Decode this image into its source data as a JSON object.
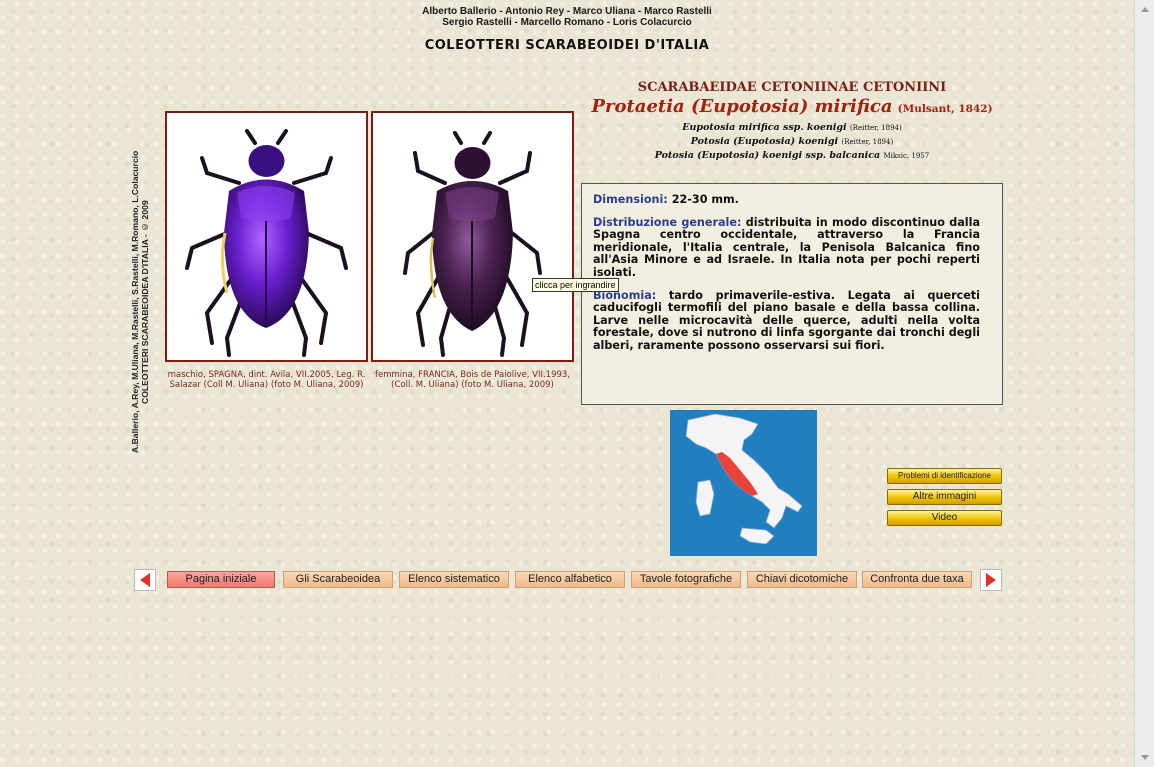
{
  "header": {
    "authors_line1": "Alberto Ballerio - Antonio Rey - Marco Uliana - Marco Rastelli",
    "authors_line2": "Sergio Rastelli - Marcello Romano - Loris Colacurcio",
    "site_title": "COLEOTTERI SCARABEOIDEI D'ITALIA"
  },
  "sidebar_credit": {
    "line1": "A.Ballerio, A.Rey, M.Uliana, M.Rastelli, S.Rastelli, M.Romano, L.Colacurcio",
    "line2": "COLEOTTERI SCARABEOIDEA D'ITALIA - © 2009"
  },
  "photos": [
    {
      "caption": "maschio, SPAGNA, dint. Avila, VII.2005, Leg. R. Salazar (Coll M. Uliana) (foto M. Uliana, 2009)"
    },
    {
      "caption": "femmina, FRANCIA, Bois de Paiolive, VII.1993, (Coll. M. Uliana) (foto M. Uliana, 2009)"
    }
  ],
  "tooltip": "clicca per ingrandire",
  "taxon": {
    "family": "SCARABAEIDAE CETONIINAE CETONIINI",
    "name": "Protaetia (Eupotosia) mirifica",
    "author": "(Mulsant, 1842)",
    "synonyms": [
      {
        "name": "Eupotosia mirifica ssp. koenigi",
        "author": "(Reitter, 1894)"
      },
      {
        "name": "Potosia (Eupotosia) koenigi",
        "author": "(Reitter, 1894)"
      },
      {
        "name": "Potosia (Eupotosia) koenigi ssp. balcanica",
        "author": "Miksic, 1957"
      }
    ]
  },
  "info": {
    "dim_label": "Dimensioni:",
    "dim_text": " 22-30 mm.",
    "distr_label": "Distribuzione generale:",
    "distr_text": " distribuita in modo discontinuo dalla Spagna centro occidentale, attraverso la Francia meridionale, l'Italia centrale, la Penisola Balcanica fino all'Asia Minore e ad Israele. In Italia nota per pochi reperti isolati.",
    "bio_label": "Bionomia:",
    "bio_text": " tardo primaverile-estiva.  Legata ai querceti caducifogli termofili del piano basale e della bassa collina. Larve nelle microcavità delle querce, adulti nella volta forestale, dove si nutrono di linfa sgorgante dai tronchi degli alberi,  raramente possono osservarsi sui fiori."
  },
  "side_buttons": {
    "problems": "Problemi di identificazione",
    "more_images": "Altre immagini",
    "video": "Video"
  },
  "nav": {
    "items": [
      "Pagina iniziale",
      "Gli Scarabeoidea",
      "Elenco sistematico",
      "Elenco alfabetico",
      "Tavole fotografiche",
      "Chiavi dicotomiche",
      "Confronta due taxa"
    ]
  },
  "colors": {
    "arrow": "#e03028",
    "frame": "#7a1d14",
    "label_blue": "#2b3f8f",
    "map_sea": "#1f7fbf",
    "map_range": "#e8433a"
  }
}
